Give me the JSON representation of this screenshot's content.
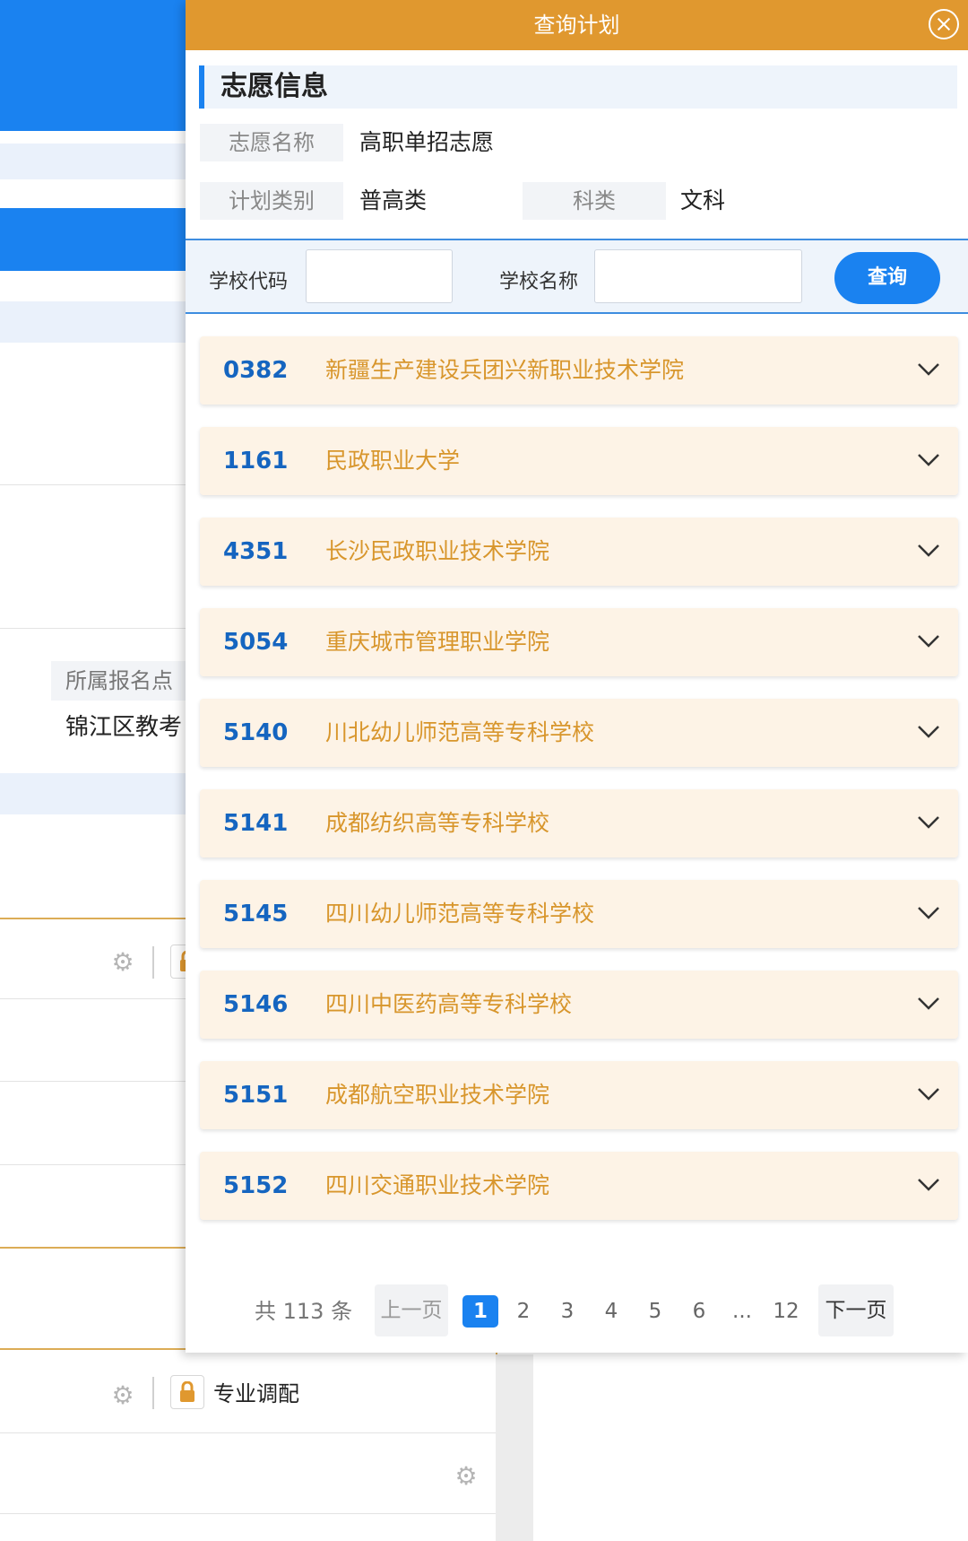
{
  "background": {
    "label": "所属报名点",
    "value": "锦江区教考",
    "lock_label": "专业调配"
  },
  "dialog": {
    "title": "查询计划",
    "section_title": "志愿信息",
    "fields": {
      "name_label": "志愿名称",
      "name_value": "高职单招志愿",
      "category_label": "计划类别",
      "category_value": "普高类",
      "subject_label": "科类",
      "subject_value": "文科"
    },
    "search": {
      "code_label": "学校代码",
      "code_value": "",
      "name_label": "学校名称",
      "name_value": "",
      "button_label": "查询"
    },
    "schools": [
      {
        "code": "0382",
        "name": "新疆生产建设兵团兴新职业技术学院"
      },
      {
        "code": "1161",
        "name": "民政职业大学"
      },
      {
        "code": "4351",
        "name": "长沙民政职业技术学院"
      },
      {
        "code": "5054",
        "name": "重庆城市管理职业学院"
      },
      {
        "code": "5140",
        "name": "川北幼儿师范高等专科学校"
      },
      {
        "code": "5141",
        "name": "成都纺织高等专科学校"
      },
      {
        "code": "5145",
        "name": "四川幼儿师范高等专科学校"
      },
      {
        "code": "5146",
        "name": "四川中医药高等专科学校"
      },
      {
        "code": "5151",
        "name": "成都航空职业技术学院"
      },
      {
        "code": "5152",
        "name": "四川交通职业技术学院"
      }
    ],
    "pagination": {
      "total": "共 113 条",
      "prev": "上一页",
      "next": "下一页",
      "pages": [
        "1",
        "2",
        "3",
        "4",
        "5",
        "6",
        "...",
        "12"
      ],
      "current": "1"
    }
  },
  "colors": {
    "header": "#e0982f",
    "accent": "#1a82f0",
    "row_bg": "#fdf3e6",
    "school_name": "#d8962c",
    "school_code": "#1565c0"
  }
}
